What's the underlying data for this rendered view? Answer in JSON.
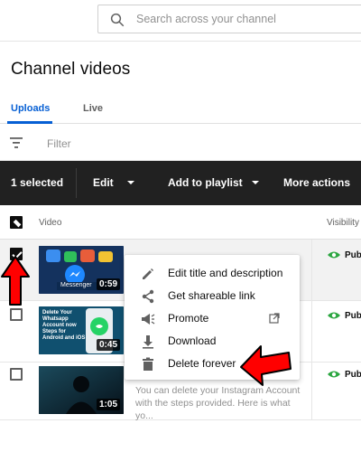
{
  "search": {
    "placeholder": "Search across your channel"
  },
  "page": {
    "title": "Channel videos"
  },
  "tabs": [
    {
      "label": "Uploads",
      "active": true
    },
    {
      "label": "Live",
      "active": false
    }
  ],
  "filter": {
    "label": "Filter"
  },
  "action_bar": {
    "selected_label": "1 selected",
    "edit_label": "Edit",
    "playlist_label": "Add to playlist",
    "more_label": "More actions"
  },
  "table": {
    "header": {
      "video": "Video",
      "visibility": "Visibility"
    },
    "rows": [
      {
        "duration": "0:59",
        "visibility": "Pub",
        "selected": true,
        "thumb_text": "Messenger"
      },
      {
        "duration": "0:45",
        "visibility": "Pub",
        "selected": false,
        "thumb_text": "Delete Your Whatsapp Account now Steps for Android and iOS"
      },
      {
        "duration": "1:05",
        "visibility": "Pub",
        "selected": false,
        "description": "You can delete your Instagram Account with the steps provided. Here is what yo..."
      }
    ]
  },
  "context_menu": {
    "items": [
      {
        "label": "Edit title and description",
        "icon": "pencil-icon"
      },
      {
        "label": "Get shareable link",
        "icon": "share-icon"
      },
      {
        "label": "Promote",
        "icon": "megaphone-icon"
      },
      {
        "label": "Download",
        "icon": "download-icon"
      },
      {
        "label": "Delete forever",
        "icon": "trash-icon"
      }
    ]
  },
  "colors": {
    "accent": "#065fd4",
    "action_bar": "#212121",
    "annotation_arrow": "#ff0000",
    "visibility_eye": "#2ba640"
  }
}
